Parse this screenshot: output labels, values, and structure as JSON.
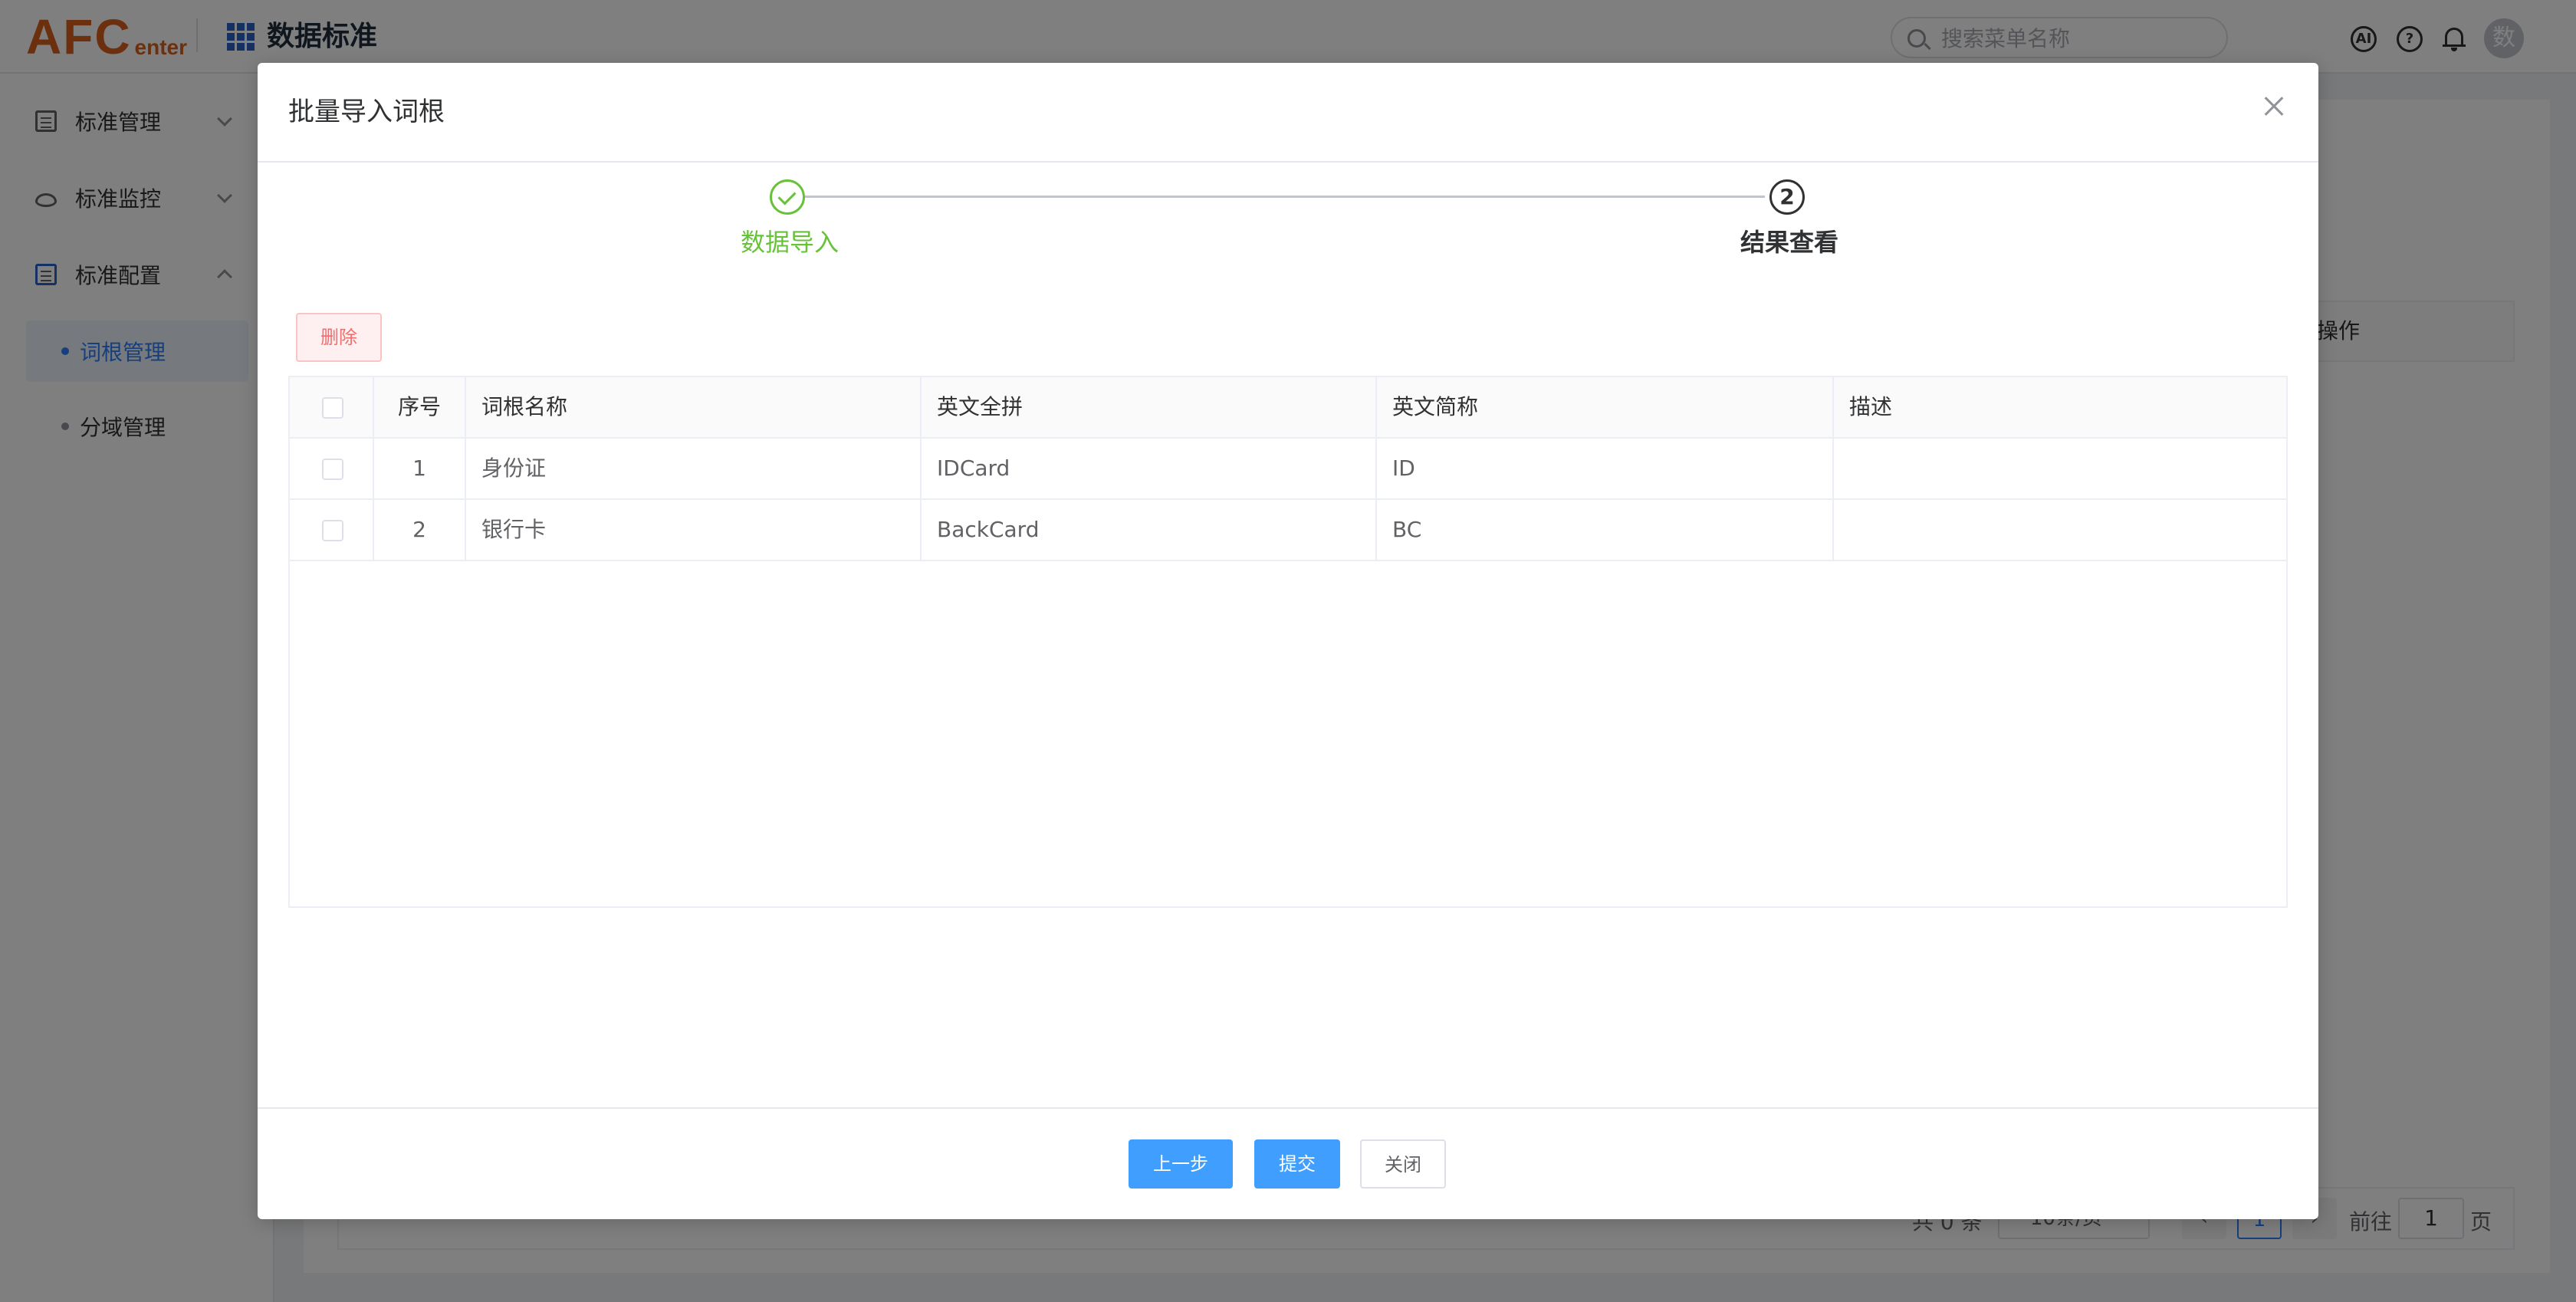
{
  "header": {
    "logo_big": "AFC",
    "logo_small": "enter",
    "app_title": "数据标准",
    "search_placeholder": "搜索菜单名称",
    "ai_icon_text": "AI",
    "help_icon_text": "?",
    "avatar_text": "数"
  },
  "sidebar": {
    "items": [
      {
        "label": "标准管理",
        "icon": "document-icon",
        "expanded": false
      },
      {
        "label": "标准监控",
        "icon": "monitor-icon",
        "expanded": false
      },
      {
        "label": "标准配置",
        "icon": "document-icon",
        "expanded": true
      }
    ],
    "subitems": [
      {
        "label": "词根管理",
        "active": true
      },
      {
        "label": "分域管理",
        "active": false
      }
    ]
  },
  "background": {
    "table_op_header": "操作",
    "pager": {
      "total": "共 0 条",
      "page_size": "10条/页",
      "current_page": "1",
      "goto_label": "前往",
      "goto_value": "1",
      "page_suffix": "页"
    }
  },
  "dialog": {
    "title": "批量导入词根",
    "steps": [
      {
        "label": "数据导入",
        "status": "finished"
      },
      {
        "label": "结果查看",
        "number": "2",
        "status": "process"
      }
    ],
    "delete_label": "删除",
    "table": {
      "columns": [
        "序号",
        "词根名称",
        "英文全拼",
        "英文简称",
        "描述"
      ],
      "rows": [
        {
          "no": "1",
          "name": "身份证",
          "en_full": "IDCard",
          "en_abbr": "ID",
          "desc": ""
        },
        {
          "no": "2",
          "name": "银行卡",
          "en_full": "BackCard",
          "en_abbr": "BC",
          "desc": ""
        }
      ]
    },
    "buttons": {
      "prev": "上一步",
      "submit": "提交",
      "close": "关闭"
    }
  },
  "colors": {
    "primary": "#409eff",
    "success": "#67c23a",
    "danger": "#f56c6c",
    "brand": "#d9611c",
    "active_menu": "#2d7ff9"
  }
}
